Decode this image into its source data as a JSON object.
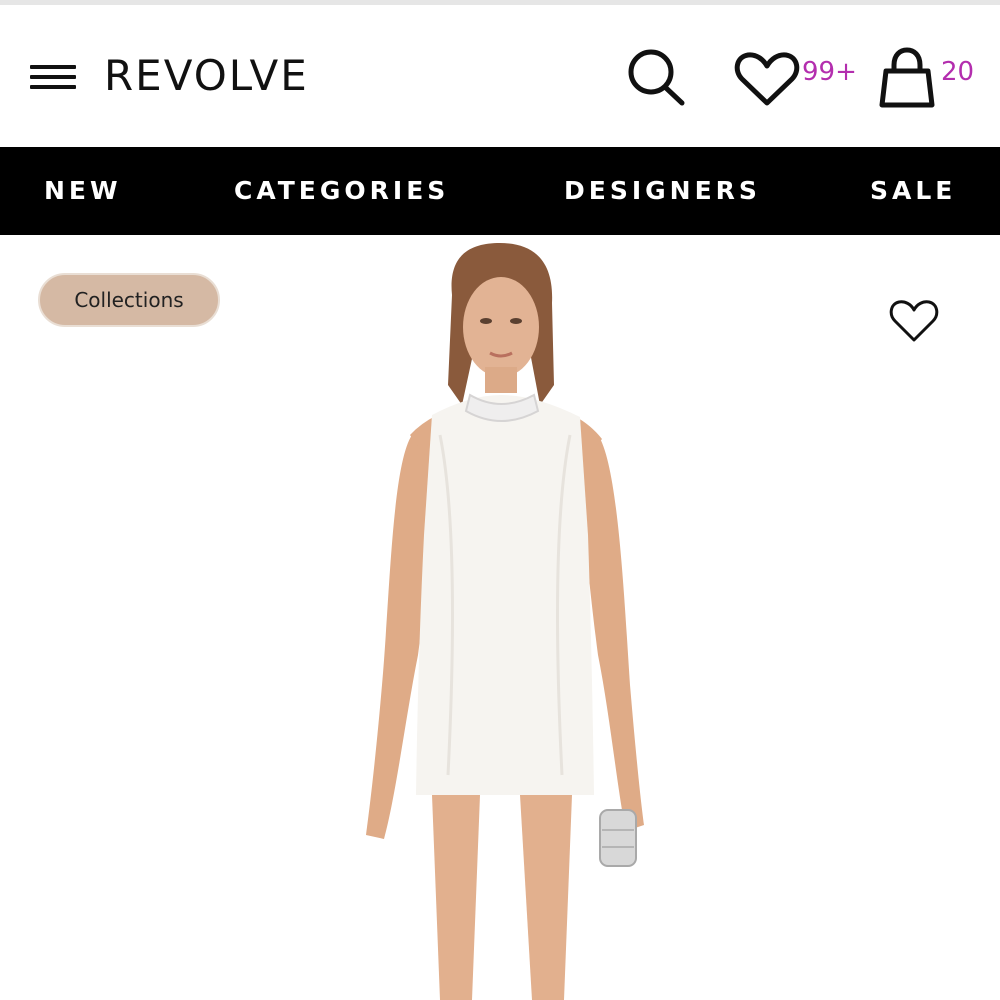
{
  "header": {
    "logo": "REVOLVE",
    "wishlist_count": "99+",
    "bag_count": "20",
    "icons": [
      "menu-icon",
      "search-icon",
      "heart-icon",
      "shopping-bag-icon"
    ]
  },
  "nav": {
    "items": [
      {
        "label": "NEW"
      },
      {
        "label": "CATEGORIES"
      },
      {
        "label": "DESIGNERS"
      },
      {
        "label": "SALE"
      }
    ]
  },
  "product": {
    "collections_label": "Collections",
    "favorite_icon": "heart-outline-icon",
    "image": "model-wearing-white-halter-mini-dress-image"
  },
  "colors": {
    "accent": "#b32eae",
    "nav_bg": "#000000",
    "pill_bg": "#d5b9a4"
  }
}
